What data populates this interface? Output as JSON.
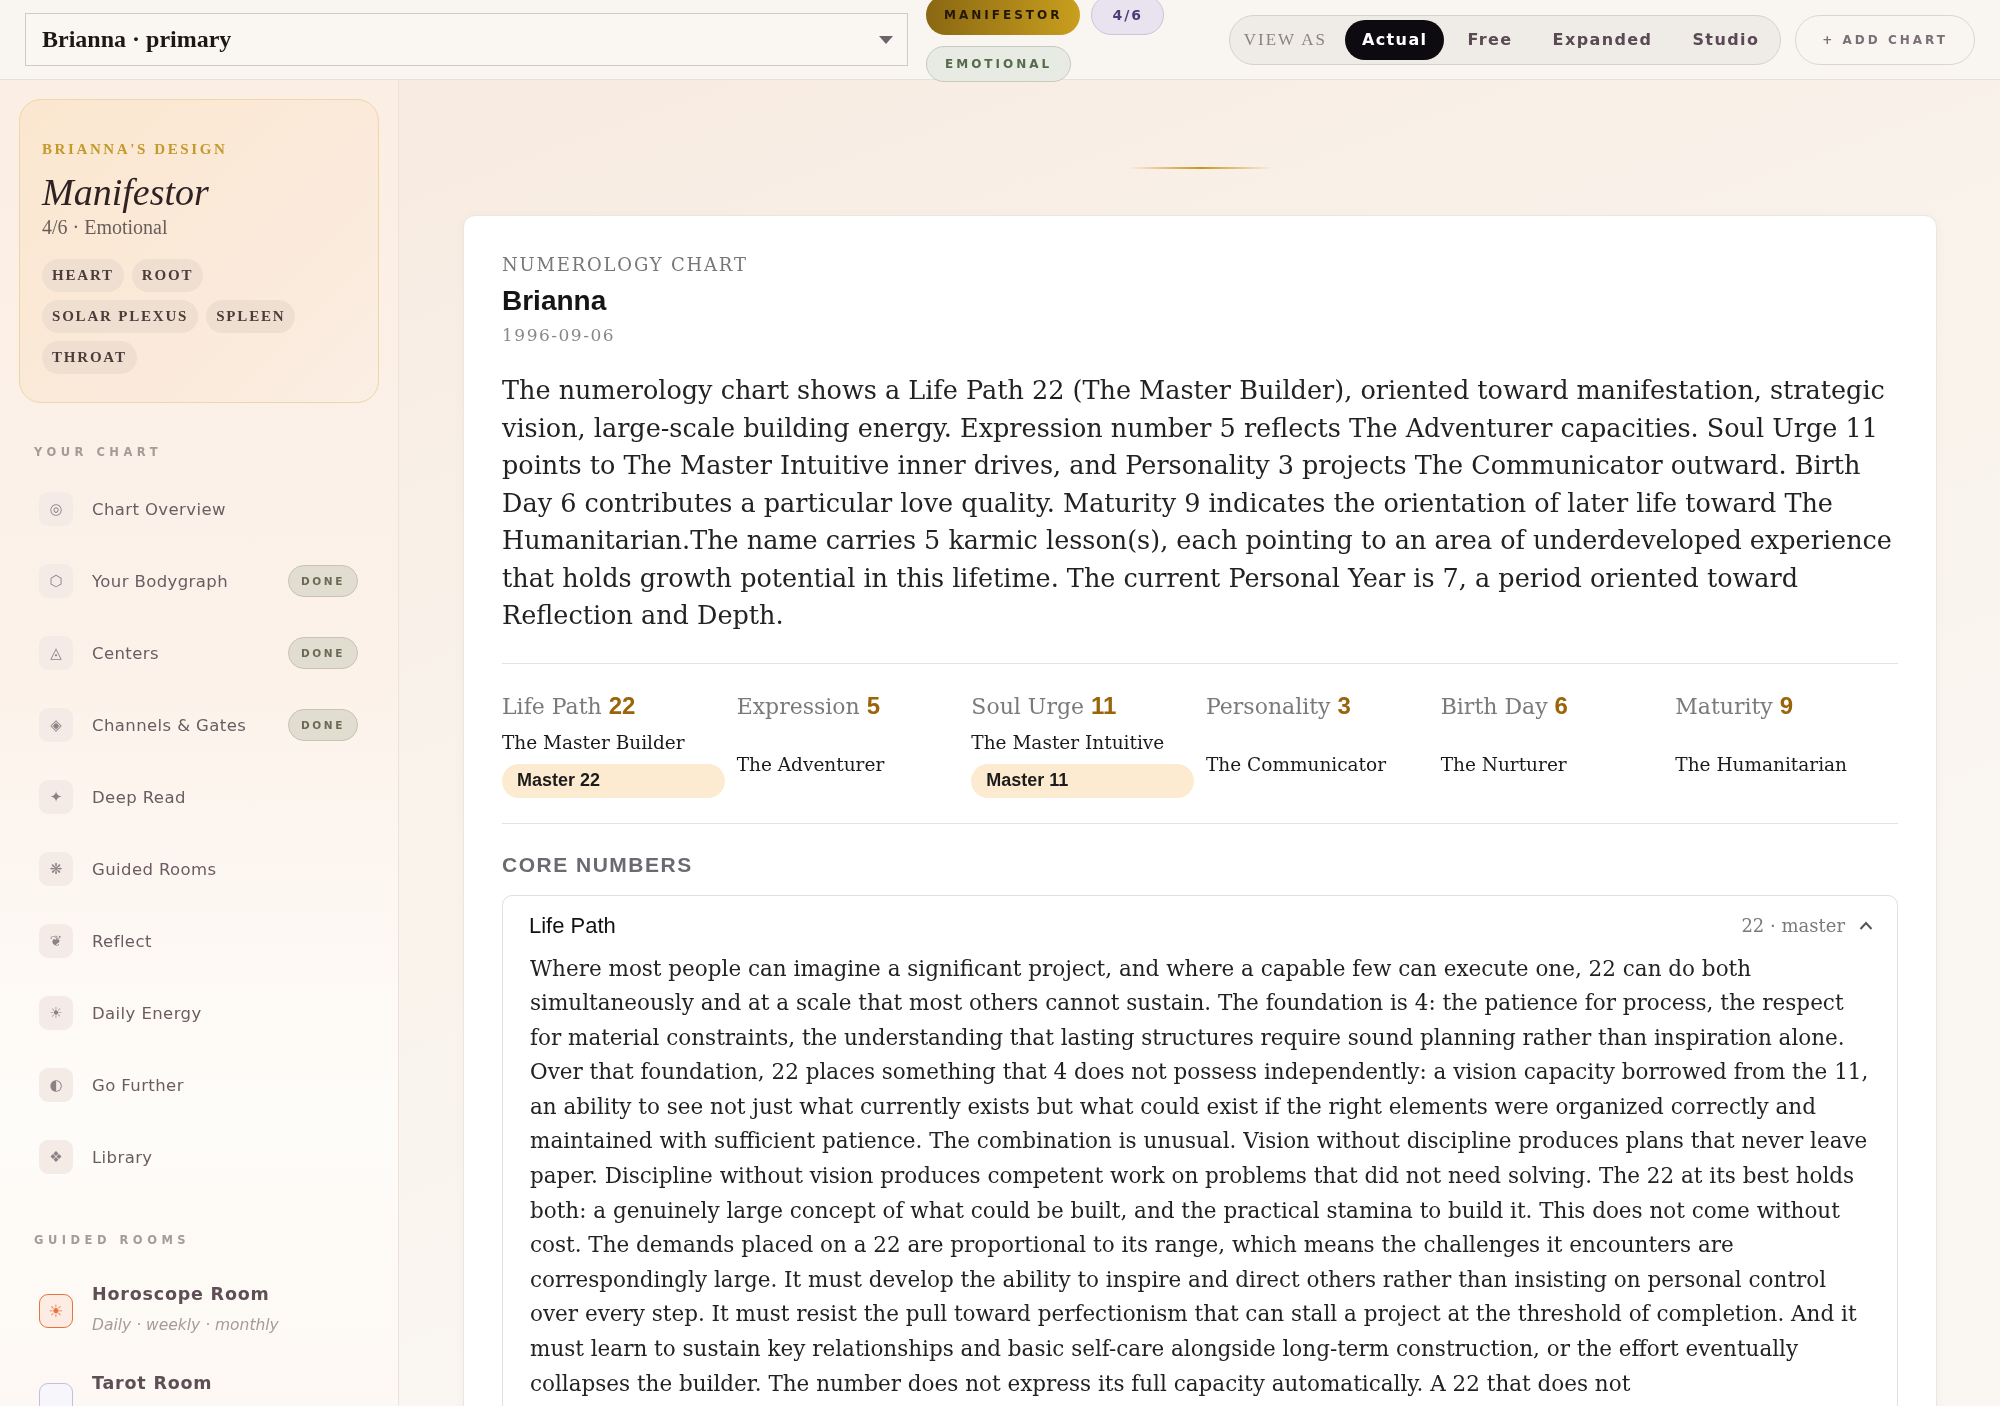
{
  "top_bar": {
    "profile_select": {
      "value": "Brianna · primary"
    },
    "badges": [
      {
        "label": "MANIFESTOR",
        "kind": "type"
      },
      {
        "label": "4/6",
        "kind": "profile"
      },
      {
        "label": "EMOTIONAL",
        "kind": "authority"
      }
    ],
    "view_as": {
      "label": "VIEW AS",
      "options": [
        {
          "label": "Actual",
          "selected": true
        },
        {
          "label": "Free",
          "selected": false
        },
        {
          "label": "Expanded",
          "selected": false
        },
        {
          "label": "Studio",
          "selected": false
        }
      ]
    },
    "add_chart_button": "+ ADD CHART"
  },
  "sidebar": {
    "design_card": {
      "eyebrow": "BRIANNA'S DESIGN",
      "type": "Manifestor",
      "summary": "4/6 · Emotional",
      "centers": [
        "HEART",
        "ROOT",
        "SOLAR PLEXUS",
        "SPLEEN",
        "THROAT"
      ]
    },
    "chart_nav": {
      "heading": "YOUR CHART",
      "items": [
        {
          "icon": "◎",
          "label": "Chart Overview"
        },
        {
          "icon": "⬡",
          "label": "Your Bodygraph",
          "badge": "DONE"
        },
        {
          "icon": "◬",
          "label": "Centers",
          "badge": "DONE"
        },
        {
          "icon": "◈",
          "label": "Channels & Gates",
          "badge": "DONE"
        },
        {
          "icon": "✦",
          "label": "Deep Read"
        },
        {
          "icon": "❋",
          "label": "Guided Rooms"
        },
        {
          "icon": "❦",
          "label": "Reflect"
        },
        {
          "icon": "☀",
          "label": "Daily Energy"
        },
        {
          "icon": "◐",
          "label": "Go Further"
        },
        {
          "icon": "❖",
          "label": "Library"
        }
      ]
    },
    "rooms": {
      "heading": "GUIDED ROOMS",
      "items": [
        {
          "icon": "☀",
          "label": "Horoscope Room",
          "subtitle": "Daily · weekly · monthly",
          "color": "#e8743b"
        },
        {
          "label": "Tarot Room",
          "color": "#c7bce3"
        }
      ]
    }
  },
  "main": {
    "chart_card": {
      "eyebrow": "NUMEROLOGY CHART",
      "name": "Brianna",
      "birth_date": "1996-09-06",
      "summary": "The numerology chart shows a Life Path 22 (The Master Builder), oriented toward manifestation, strategic vision, large-scale building energy. Expression number 5 reflects The Adventurer capacities. Soul Urge 11 points to The Master Intuitive inner drives, and Personality 3 projects The Communicator outward. Birth Day 6 contributes a particular love quality. Maturity 9 indicates the orientation of later life toward The Humanitarian.The name carries 5 karmic lesson(s), each pointing to an area of underdeveloped experience that holds growth potential in this lifetime. The current Personal Year is 7, a period oriented toward Reflection and Depth.",
      "numbers": [
        {
          "label": "Life Path",
          "value": "22",
          "title": "The Master Builder",
          "badge": "Master 22"
        },
        {
          "label": "Expression",
          "value": "5",
          "title": "The Adventurer"
        },
        {
          "label": "Soul Urge",
          "value": "11",
          "title": "The Master Intuitive",
          "badge": "Master 11"
        },
        {
          "label": "Personality",
          "value": "3",
          "title": "The Communicator"
        },
        {
          "label": "Birth Day",
          "value": "6",
          "title": "The Nurturer"
        },
        {
          "label": "Maturity",
          "value": "9",
          "title": "The Humanitarian"
        }
      ],
      "section_heading": "CORE NUMBERS",
      "details": [
        {
          "title": "Life Path",
          "meta": "22 · master",
          "expanded": true,
          "body": "Where most people can imagine a significant project, and where a capable few can execute one, 22 can do both simultaneously and at a scale that most others cannot sustain. The foundation is 4: the patience for process, the respect for material constraints, the understanding that lasting structures require sound planning rather than inspiration alone. Over that foundation, 22 places something that 4 does not possess independently: a vision capacity borrowed from the 11, an ability to see not just what currently exists but what could exist if the right elements were organized correctly and maintained with sufficient patience. The combination is unusual. Vision without discipline produces plans that never leave paper. Discipline without vision produces competent work on problems that did not need solving. The 22 at its best holds both: a genuinely large concept of what could be built, and the practical stamina to build it. This does not come without cost. The demands placed on a 22 are proportional to its range, which means the challenges it encounters are correspondingly large. It must develop the ability to inspire and direct others rather than insisting on personal control over every step. It must resist the pull toward perfectionism that can stall a project at the threshold of completion. And it must learn to sustain key relationships and basic self-care alongside long-term construction, or the effort eventually collapses the builder. The number does not express its full capacity automatically. A 22 that does not"
        }
      ]
    }
  }
}
